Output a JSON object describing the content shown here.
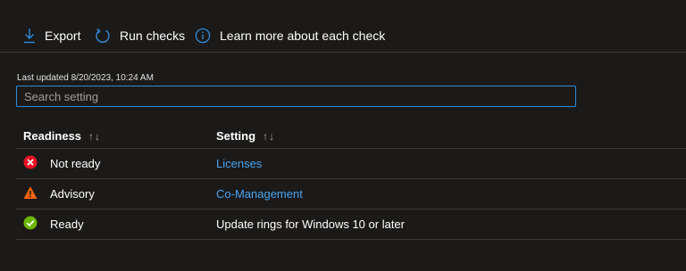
{
  "toolbar": {
    "export_label": "Export",
    "run_checks_label": "Run checks",
    "learn_more_label": "Learn more about each check",
    "accent_color": "#2f8bd8"
  },
  "search": {
    "last_updated": "Last updated 8/20/2023, 10:24 AM",
    "placeholder": "Search setting",
    "value": ""
  },
  "table": {
    "columns": [
      {
        "label": "Readiness",
        "sort_glyph": "↑↓"
      },
      {
        "label": "Setting",
        "sort_glyph": "↑↓"
      }
    ],
    "rows": [
      {
        "status": "Not ready",
        "status_icon": "error-x-icon",
        "status_color": "#e81123",
        "setting": "Licenses",
        "setting_is_link": true
      },
      {
        "status": "Advisory",
        "status_icon": "warning-triangle-icon",
        "status_color": "#f7630c",
        "setting": "Co-Management",
        "setting_is_link": true
      },
      {
        "status": "Ready",
        "status_icon": "check-circle-icon",
        "status_color": "#6bb700",
        "setting": "Update rings for Windows 10 or later",
        "setting_is_link": false
      }
    ]
  }
}
